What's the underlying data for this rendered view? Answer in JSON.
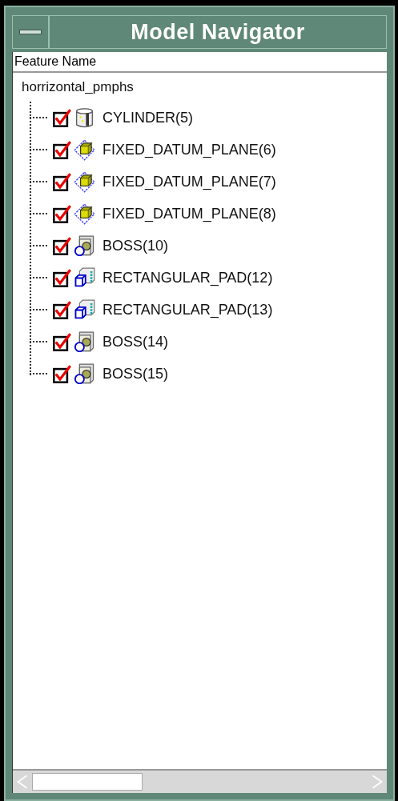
{
  "window": {
    "title": "Model Navigator"
  },
  "column_header": "Feature Name",
  "tree": {
    "label": "horrizontal_pmphs",
    "children": [
      {
        "label": "CYLINDER(5)",
        "kind": "cylinder",
        "checked": true
      },
      {
        "label": "FIXED_DATUM_PLANE(6)",
        "kind": "datum",
        "checked": true
      },
      {
        "label": "FIXED_DATUM_PLANE(7)",
        "kind": "datum",
        "checked": true
      },
      {
        "label": "FIXED_DATUM_PLANE(8)",
        "kind": "datum",
        "checked": true
      },
      {
        "label": "BOSS(10)",
        "kind": "boss",
        "checked": true
      },
      {
        "label": "RECTANGULAR_PAD(12)",
        "kind": "pad",
        "checked": true
      },
      {
        "label": "RECTANGULAR_PAD(13)",
        "kind": "pad",
        "checked": true
      },
      {
        "label": "BOSS(14)",
        "kind": "boss",
        "checked": true
      },
      {
        "label": "BOSS(15)",
        "kind": "boss",
        "checked": true
      }
    ]
  }
}
